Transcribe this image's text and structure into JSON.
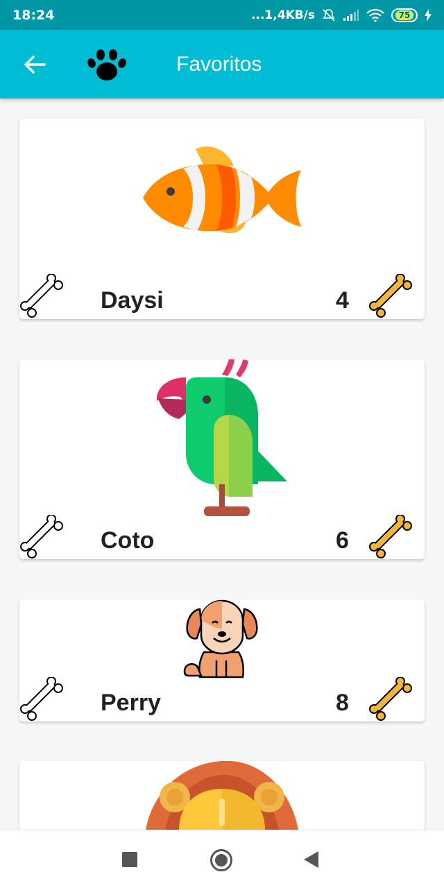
{
  "status_bar": {
    "time": "18:24",
    "network_speed": "...1,4KB/s",
    "battery": "75"
  },
  "app_bar": {
    "title": "Favoritos",
    "back_icon": "arrow-left-icon",
    "logo_icon": "paw-icon"
  },
  "favorites": [
    {
      "name": "Daysi",
      "count": "4",
      "icon": "clownfish"
    },
    {
      "name": "Coto",
      "count": "6",
      "icon": "parrot"
    },
    {
      "name": "Perry",
      "count": "8",
      "icon": "dog"
    },
    {
      "name": "",
      "count": "",
      "icon": "lion"
    }
  ],
  "colors": {
    "status_bar": "#0097a7",
    "app_bar": "#00bcd4",
    "bone_active": "#f4b63a"
  }
}
